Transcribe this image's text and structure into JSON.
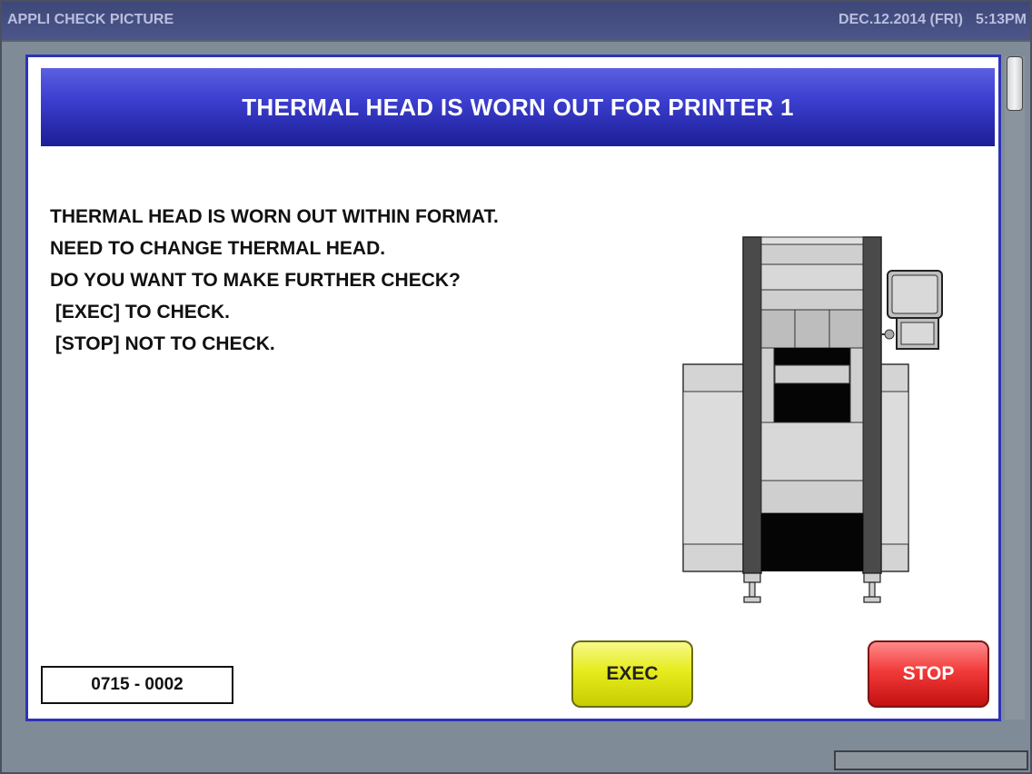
{
  "titlebar": {
    "app_title": "APPLI CHECK PICTURE",
    "date": "DEC.12.2014 (FRI)",
    "time": "5:13PM"
  },
  "dialog": {
    "header": "THERMAL HEAD IS WORN OUT FOR PRINTER 1",
    "message_lines": [
      "THERMAL HEAD IS WORN OUT WITHIN FORMAT.",
      "NEED TO CHANGE THERMAL HEAD.",
      "DO YOU WANT TO MAKE FURTHER CHECK?",
      " [EXEC] TO CHECK.",
      " [STOP] NOT TO CHECK."
    ],
    "code": "0715 - 0002",
    "exec_label": "EXEC",
    "stop_label": "STOP",
    "illustration_icon": "printer-machine-icon"
  },
  "colors": {
    "header_blue": "#3c3fcf",
    "dialog_border": "#2d33b8",
    "exec_yellow": "#e6ec1c",
    "stop_red": "#f23a3a",
    "background": "#7f8c97"
  }
}
